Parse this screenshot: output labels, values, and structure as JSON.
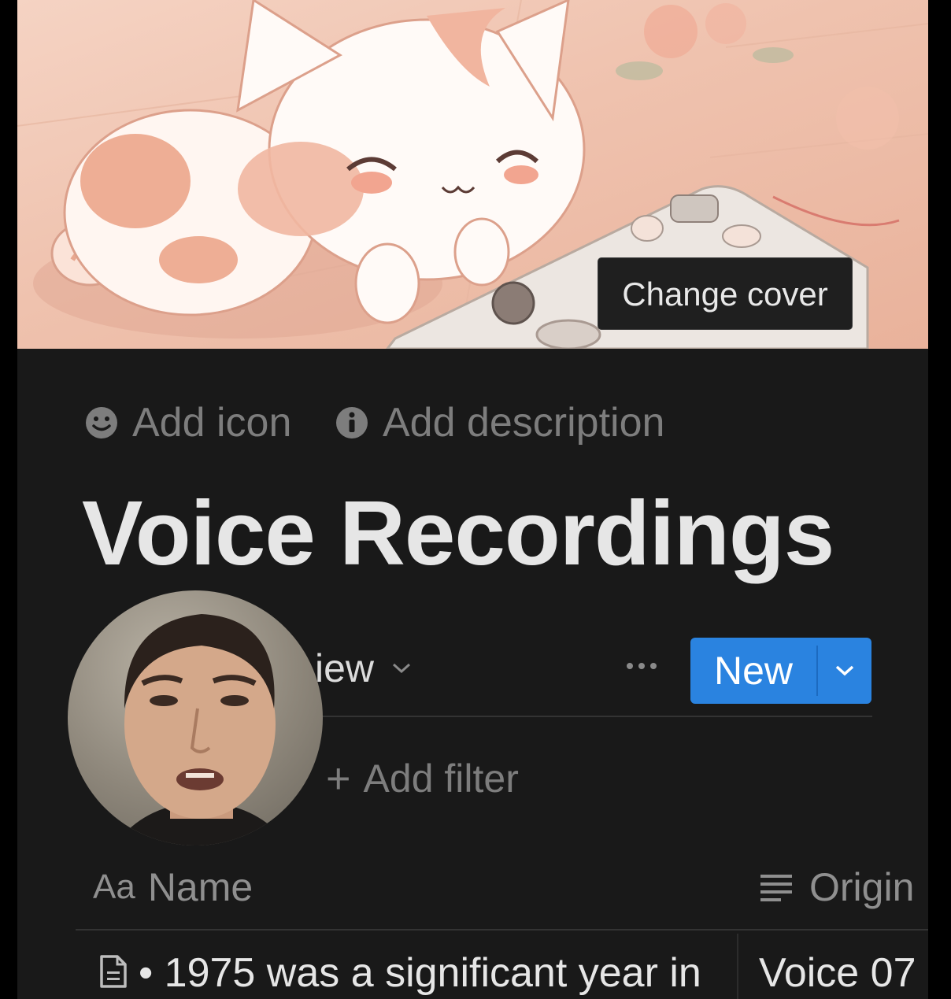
{
  "cover": {
    "change_cover_label": "Change cover"
  },
  "page_actions": {
    "add_icon_label": "Add icon",
    "add_description_label": "Add description"
  },
  "page": {
    "title": "Voice Recordings"
  },
  "database": {
    "view_label": "iew",
    "more_label": "···",
    "new_label": "New",
    "add_filter_label": "Add filter",
    "columns": [
      {
        "label": "Name",
        "icon_text": "Aa",
        "icon": "text-property-icon"
      },
      {
        "label": "Origin",
        "icon": "lines-property-icon"
      }
    ],
    "rows": [
      {
        "name": "• 1975 was a significant year in",
        "origin": "Voice 07"
      }
    ]
  },
  "colors": {
    "background": "#191919",
    "accent": "#2a83e0",
    "text_primary": "#e6e6e6",
    "text_secondary": "#7d7d7d"
  }
}
